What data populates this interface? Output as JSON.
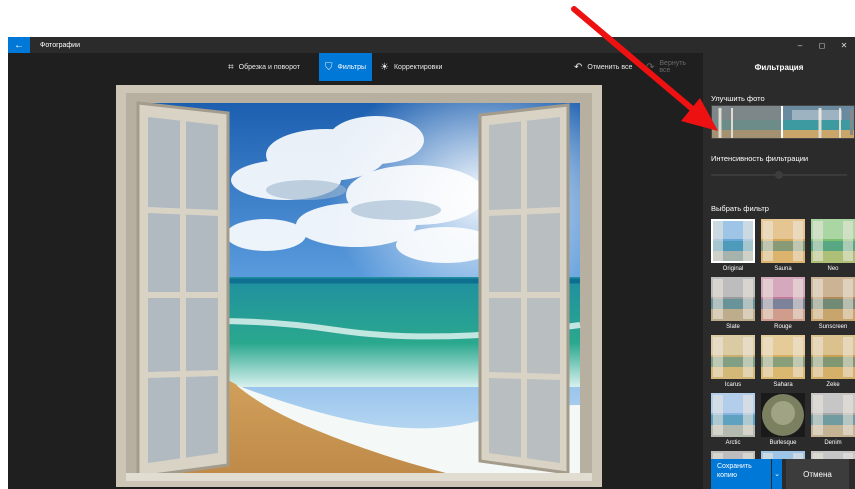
{
  "app": {
    "title": "Фотографии",
    "back_icon": "back-arrow-icon",
    "controls": {
      "minimize": "–",
      "maximize": "◻",
      "close": "✕"
    }
  },
  "toolbar": {
    "crop": {
      "label": "Обрезка и поворот",
      "icon": "crop-icon",
      "glyph": "⌗"
    },
    "filters": {
      "label": "Фильтры",
      "icon": "filter-icon",
      "glyph": "⛉"
    },
    "adjust": {
      "label": "Корректировки",
      "icon": "sun-icon",
      "glyph": "☀"
    },
    "undo_all": {
      "label": "Отменить все",
      "icon": "undo-icon",
      "glyph": "↶"
    },
    "redo_all": {
      "label": "Вернуть все",
      "icon": "redo-icon",
      "glyph": "↷"
    }
  },
  "pane": {
    "title": "Фильтрация",
    "enhance_label": "Улучшить фото",
    "intensity_label": "Интенсивность фильтрации",
    "choose_label": "Выбрать фильтр",
    "filters": [
      {
        "name": "Original",
        "tint": "#6aa6d8"
      },
      {
        "name": "Sauna",
        "tint": "#d8a85a"
      },
      {
        "name": "Neo",
        "tint": "#7cc070"
      },
      {
        "name": "Slate",
        "tint": "#9a9a9a"
      },
      {
        "name": "Rouge",
        "tint": "#c07a9a"
      },
      {
        "name": "Sunscreen",
        "tint": "#b08a5a"
      },
      {
        "name": "Icarus",
        "tint": "#c8b070"
      },
      {
        "name": "Sahara",
        "tint": "#d6b060"
      },
      {
        "name": "Zeke",
        "tint": "#c8a050"
      },
      {
        "name": "Arctic",
        "tint": "#8ab4e0"
      },
      {
        "name": "Burlesque",
        "tint": "#7a8060"
      },
      {
        "name": "Denim",
        "tint": "#a8a8a8"
      }
    ],
    "save_label": "Сохранить копию",
    "save_dropdown": "⌄",
    "cancel_label": "Отмена"
  }
}
